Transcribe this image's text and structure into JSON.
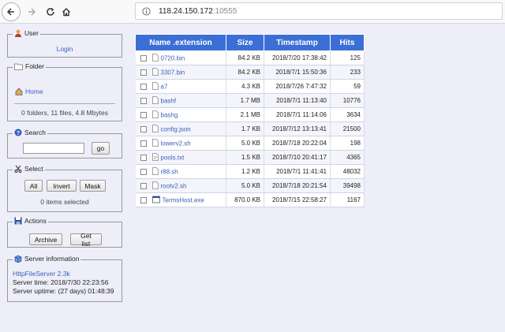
{
  "browser": {
    "url_host": "118.24.150.172",
    "url_port": ":10555"
  },
  "user": {
    "legend": "User",
    "login_label": "Login"
  },
  "folder": {
    "legend": "Folder",
    "home_label": "Home",
    "stats": "0 folders, 11 files, 4.8 Mbytes"
  },
  "search": {
    "legend": "Search",
    "value": "",
    "go_label": "go"
  },
  "select": {
    "legend": "Select",
    "all_label": "All",
    "invert_label": "Invert",
    "mask_label": "Mask",
    "selected_text": "0 items selected"
  },
  "actions": {
    "legend": "Actions",
    "archive_label": "Archive",
    "getlist_label": "Get list"
  },
  "server": {
    "legend": "Server information",
    "name": "HttpFileServer 2.3k",
    "time": "Server time: 2018/7/30 22:23:56",
    "uptime": "Server uptime: (27 days) 01:48:39"
  },
  "table": {
    "headers": {
      "name": "Name .extension",
      "size": "Size",
      "timestamp": "Timestamp",
      "hits": "Hits"
    },
    "rows": [
      {
        "name": "0720.bin",
        "size": "84.2 KB",
        "timestamp": "2018/7/20 17:38:42",
        "hits": "125",
        "icon": "file-icon"
      },
      {
        "name": "3307.bin",
        "size": "84.2 KB",
        "timestamp": "2018/7/1 15:50:36",
        "hits": "233",
        "icon": "file-icon"
      },
      {
        "name": "a7",
        "size": "4.3 KB",
        "timestamp": "2018/7/26 7:47:32",
        "hits": "59",
        "icon": "file-icon"
      },
      {
        "name": "bashf",
        "size": "1.7 MB",
        "timestamp": "2018/7/1 11:13:40",
        "hits": "10776",
        "icon": "file-icon"
      },
      {
        "name": "bashg",
        "size": "2.1 MB",
        "timestamp": "2018/7/1 11:14:06",
        "hits": "3634",
        "icon": "file-icon"
      },
      {
        "name": "config.json",
        "size": "1.7 KB",
        "timestamp": "2018/7/12 13:13:41",
        "hits": "21500",
        "icon": "file-icon"
      },
      {
        "name": "lowerv2.sh",
        "size": "5.0 KB",
        "timestamp": "2018/7/18 20:22:04",
        "hits": "198",
        "icon": "file-icon"
      },
      {
        "name": "pools.txt",
        "size": "1.5 KB",
        "timestamp": "2018/7/10 20:41:17",
        "hits": "4365",
        "icon": "text-file-icon"
      },
      {
        "name": "r88.sh",
        "size": "1.2 KB",
        "timestamp": "2018/7/1 11:41:41",
        "hits": "48032",
        "icon": "file-icon"
      },
      {
        "name": "rootv2.sh",
        "size": "5.0 KB",
        "timestamp": "2018/7/18 20:21:54",
        "hits": "39498",
        "icon": "file-icon"
      },
      {
        "name": "TermsHost.exe",
        "size": "870.0 KB",
        "timestamp": "2018/7/15 22:58:27",
        "hits": "1167",
        "icon": "exe-icon"
      }
    ]
  },
  "colors": {
    "header_bg": "#3b6fd6",
    "link": "#3a5fb8",
    "page_bg": "#eeeef9"
  }
}
